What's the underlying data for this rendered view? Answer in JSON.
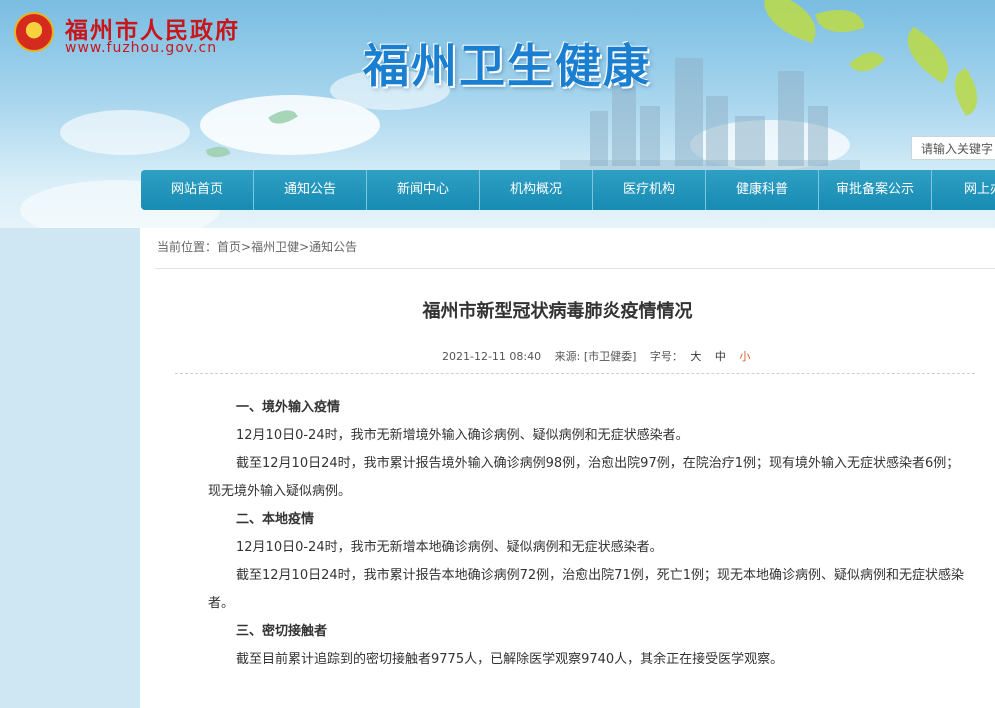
{
  "header": {
    "gov_name": "福州市人民政府",
    "gov_url": "www.fuzhou.gov.cn",
    "site_title": "福州卫生健康",
    "search_placeholder": "请输入关键字"
  },
  "nav": {
    "items": [
      "网站首页",
      "通知公告",
      "新闻中心",
      "机构概况",
      "医疗机构",
      "健康科普",
      "审批备案公示",
      "网上办"
    ]
  },
  "breadcrumb": {
    "prefix": "当前位置：",
    "items": [
      "首页",
      "福州卫健",
      "通知公告"
    ],
    "separator": ">"
  },
  "article": {
    "title": "福州市新型冠状病毒肺炎疫情情况",
    "date": "2021-12-11 08:40",
    "source": "来源: [市卫健委]",
    "font_label": "字号：",
    "font_sizes": [
      "大",
      "中",
      "小"
    ],
    "sections": [
      {
        "heading": "一、境外输入疫情",
        "paragraphs": [
          "12月10日0-24时，我市无新增境外输入确诊病例、疑似病例和无症状感染者。",
          "截至12月10日24时，我市累计报告境外输入确诊病例98例，治愈出院97例，在院治疗1例；现有境外输入无症状感染者6例；现无境外输入疑似病例。"
        ]
      },
      {
        "heading": "二、本地疫情",
        "paragraphs": [
          "12月10日0-24时，我市无新增本地确诊病例、疑似病例和无症状感染者。",
          "截至12月10日24时，我市累计报告本地确诊病例72例，治愈出院71例，死亡1例；现无本地确诊病例、疑似病例和无症状感染者。"
        ]
      },
      {
        "heading": "三、密切接触者",
        "paragraphs": [
          "截至目前累计追踪到的密切接触者9775人，已解除医学观察9740人，其余正在接受医学观察。"
        ]
      }
    ]
  },
  "colors": {
    "gov_red": "#c8161d",
    "title_blue": "#1a7fd0",
    "nav_blue": "#1e93bb",
    "active_font_size": "#e15b2b"
  }
}
